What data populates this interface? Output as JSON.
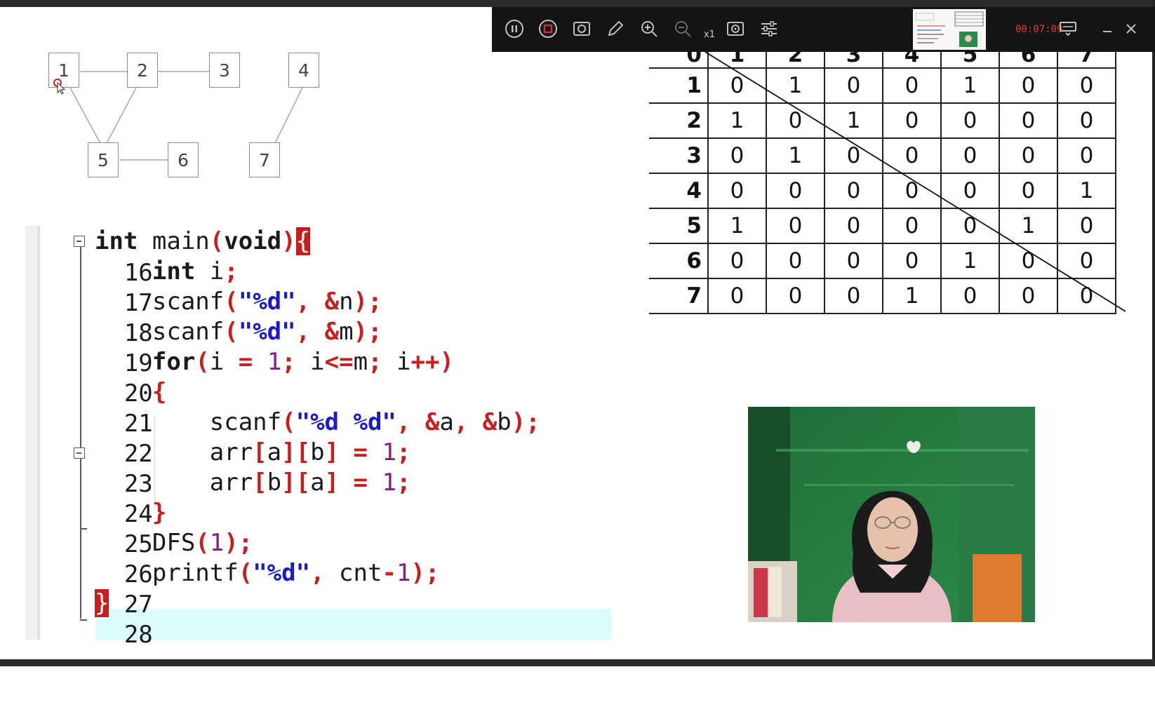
{
  "graph": {
    "nodes": [
      "1",
      "2",
      "3",
      "4",
      "5",
      "6",
      "7"
    ]
  },
  "code": {
    "lines": [
      {
        "num": "16",
        "text": "int main(void){"
      },
      {
        "num": "17",
        "text": "int i;"
      },
      {
        "num": "18",
        "text": "scanf(\"%d\", &n);"
      },
      {
        "num": "19",
        "text": "scanf(\"%d\", &m);"
      },
      {
        "num": "20",
        "text": "for(i = 1; i<=m; i++)"
      },
      {
        "num": "21",
        "text": "{"
      },
      {
        "num": "22",
        "text": "scanf(\"%d %d\", &a, &b);"
      },
      {
        "num": "23",
        "text": "arr[a][b] = 1;"
      },
      {
        "num": "24",
        "text": "arr[b][a] = 1;"
      },
      {
        "num": "25",
        "text": "}"
      },
      {
        "num": "26",
        "text": "DFS(1);"
      },
      {
        "num": "27",
        "text": "printf(\"%d\", cnt-1);"
      },
      {
        "num": "28",
        "text": "}"
      }
    ]
  },
  "recorder": {
    "speed_label": "x1",
    "timer": "00:07:09",
    "icons": [
      "pause-icon",
      "stop-icon",
      "camera-icon",
      "pen-icon",
      "zoom-in-icon",
      "zoom-out-icon",
      "screenshot-icon",
      "settings-icon",
      "display-icon",
      "minimize-icon",
      "close-icon"
    ]
  },
  "matrix": {
    "header": [
      "0",
      "1",
      "2",
      "3",
      "4",
      "5",
      "6",
      "7"
    ],
    "rows": [
      {
        "label": "1",
        "values": [
          "0",
          "1",
          "0",
          "0",
          "1",
          "0",
          "0"
        ]
      },
      {
        "label": "2",
        "values": [
          "1",
          "0",
          "1",
          "0",
          "0",
          "0",
          "0"
        ]
      },
      {
        "label": "3",
        "values": [
          "0",
          "1",
          "0",
          "0",
          "0",
          "0",
          "0"
        ]
      },
      {
        "label": "4",
        "values": [
          "0",
          "0",
          "0",
          "0",
          "0",
          "0",
          "1"
        ]
      },
      {
        "label": "5",
        "values": [
          "1",
          "0",
          "0",
          "0",
          "0",
          "1",
          "0"
        ]
      },
      {
        "label": "6",
        "values": [
          "0",
          "0",
          "0",
          "0",
          "1",
          "0",
          "0"
        ]
      },
      {
        "label": "7",
        "values": [
          "0",
          "0",
          "0",
          "1",
          "0",
          "0",
          "0"
        ]
      }
    ]
  },
  "colors": {
    "keyword": "#1a1a1a",
    "operator": "#c81e1e",
    "string": "#1a1ac8",
    "number": "#8b1a8b",
    "current_line": "#dcfcfc",
    "timer": "#e03a3a"
  }
}
